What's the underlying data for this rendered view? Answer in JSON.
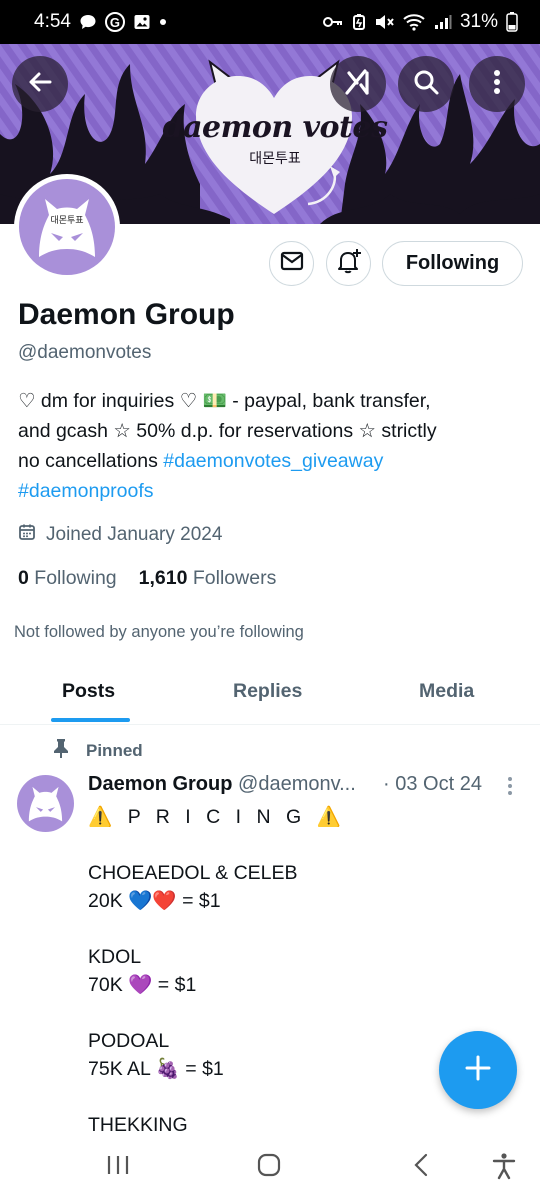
{
  "status_bar": {
    "time": "4:54",
    "google_letter": "G",
    "battery": "31%",
    "icons": [
      "chat-icon",
      "google-icon",
      "image-icon",
      "dot-icon",
      "key-icon",
      "battery-saver-icon",
      "mute-icon",
      "wifi-icon",
      "signal-icon",
      "battery-icon"
    ]
  },
  "banner": {
    "title": "daemon votes",
    "subtitle": "대몬투표",
    "colors": {
      "purple": "#8d6fd0",
      "flames": "#17121f"
    }
  },
  "header_buttons": [
    "back-icon",
    "grok-icon",
    "search-icon",
    "more-vertical-icon"
  ],
  "profile": {
    "avatar_text": "대몬투표",
    "name": "Daemon Group",
    "handle": "@daemonvotes",
    "bio_line1": "♡ dm for inquiries ♡ 💵 - paypal, bank transfer,",
    "bio_line2": "and gcash  ☆ 50% d.p. for reservations  ☆ strictly",
    "bio_line3_text": "no cancellations ",
    "bio_tag1": "#daemonvotes_giveaway",
    "bio_tag2": "#daemonproofs",
    "joined": "Joined January 2024",
    "following_count": "0",
    "following_label": "Following",
    "followers_count": "1,610",
    "followers_label": "Followers",
    "not_followed": "Not followed by anyone you’re following"
  },
  "actions": {
    "following_button": "Following"
  },
  "tabs": [
    {
      "label": "Posts",
      "active": true
    },
    {
      "label": "Replies",
      "active": false
    },
    {
      "label": "Media",
      "active": false
    }
  ],
  "post": {
    "pinned_label": "Pinned",
    "author_name": "Daemon Group",
    "author_handle": "@daemonv...",
    "date": "· 03 Oct 24",
    "lines": [
      "⚠️ P R I C I N G  ⚠️",
      "",
      "CHOEAEDOL & CELEB",
      "20K 💙❤️ = $1",
      "",
      "KDOL",
      "70K 💜 = $1",
      "",
      "PODOAL",
      "75K AL 🍇 = $1",
      "",
      "THEKKING"
    ]
  },
  "fab": {
    "icon": "plus-icon"
  },
  "nav_bar": [
    "recent-apps-icon",
    "home-icon",
    "back-icon",
    "accessibility-icon"
  ],
  "accent_color": "#1d9bf0"
}
